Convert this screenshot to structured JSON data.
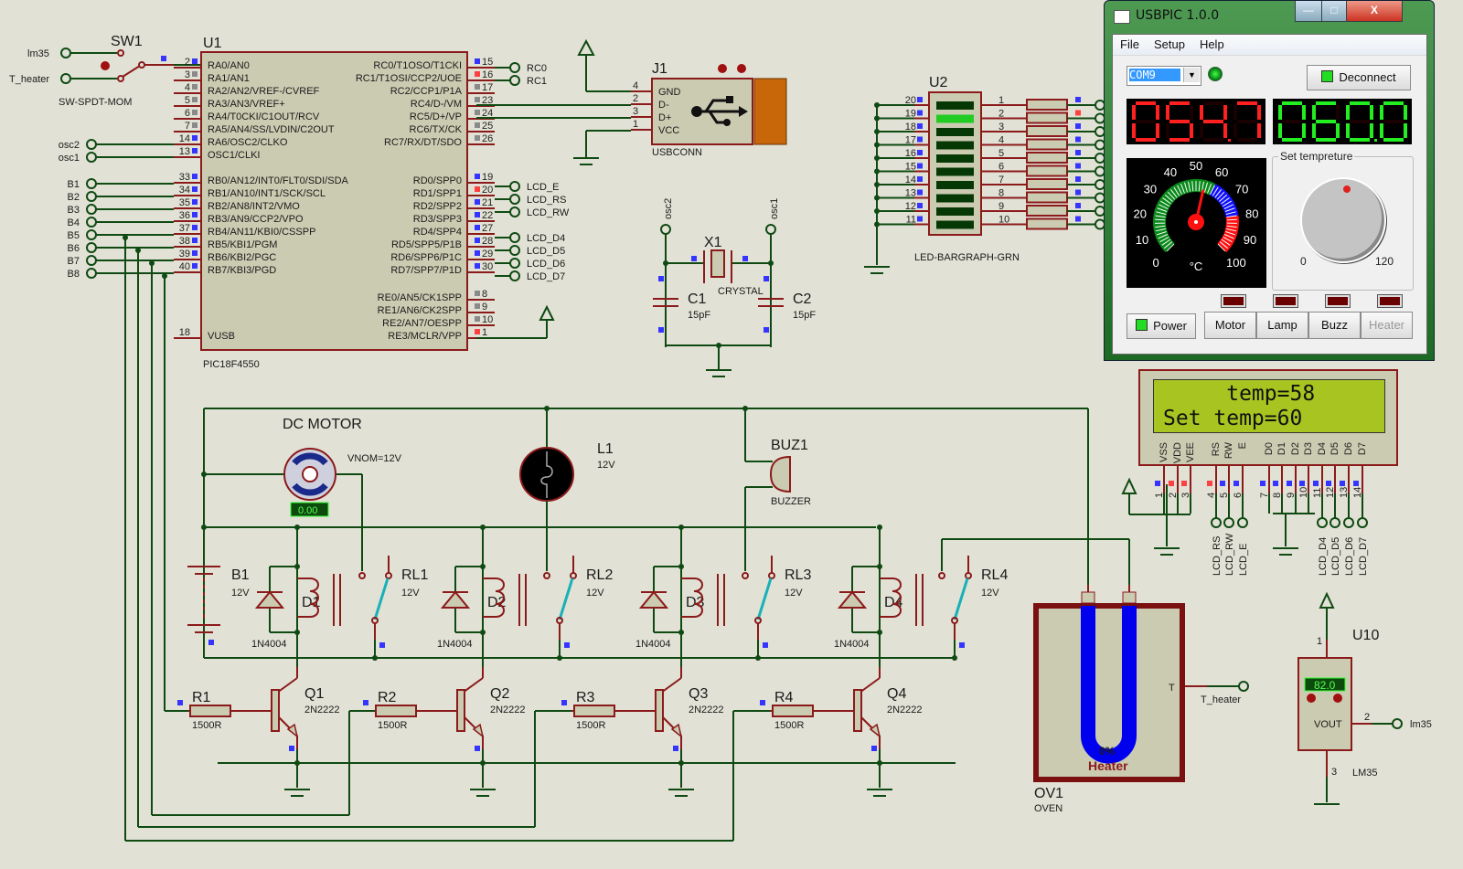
{
  "schematic": {
    "sw1": {
      "ref": "SW1",
      "type": "SW-SPDT-MOM",
      "terminals": [
        "lm35",
        "T_heater"
      ]
    },
    "u1": {
      "ref": "U1",
      "part": "PIC18F4550",
      "left_pins": [
        {
          "num": "2",
          "name": "RA0/AN0"
        },
        {
          "num": "3",
          "name": "RA1/AN1"
        },
        {
          "num": "4",
          "name": "RA2/AN2/VREF-/CVREF"
        },
        {
          "num": "5",
          "name": "RA3/AN3/VREF+"
        },
        {
          "num": "6",
          "name": "RA4/T0CKI/C1OUT/RCV"
        },
        {
          "num": "7",
          "name": "RA5/AN4/SS/LVDIN/C2OUT"
        },
        {
          "num": "14",
          "name": "RA6/OSC2/CLKO"
        },
        {
          "num": "13",
          "name": "OSC1/CLKI"
        },
        {
          "num": "33",
          "name": "RB0/AN12/INT0/FLT0/SDI/SDA"
        },
        {
          "num": "34",
          "name": "RB1/AN10/INT1/SCK/SCL"
        },
        {
          "num": "35",
          "name": "RB2/AN8/INT2/VMO"
        },
        {
          "num": "36",
          "name": "RB3/AN9/CCP2/VPO"
        },
        {
          "num": "37",
          "name": "RB4/AN11/KBI0/CSSPP"
        },
        {
          "num": "38",
          "name": "RB5/KBI1/PGM"
        },
        {
          "num": "39",
          "name": "RB6/KBI2/PGC"
        },
        {
          "num": "40",
          "name": "RB7/KBI3/PGD"
        },
        {
          "num": "18",
          "name": "VUSB"
        }
      ],
      "right_pins": [
        {
          "num": "15",
          "name": "RC0/T1OSO/T1CKI"
        },
        {
          "num": "16",
          "name": "RC1/T1OSI/CCP2/UOE"
        },
        {
          "num": "17",
          "name": "RC2/CCP1/P1A"
        },
        {
          "num": "23",
          "name": "RC4/D-/VM"
        },
        {
          "num": "24",
          "name": "RC5/D+/VP"
        },
        {
          "num": "25",
          "name": "RC6/TX/CK"
        },
        {
          "num": "26",
          "name": "RC7/RX/DT/SDO"
        },
        {
          "num": "19",
          "name": "RD0/SPP0"
        },
        {
          "num": "20",
          "name": "RD1/SPP1"
        },
        {
          "num": "21",
          "name": "RD2/SPP2"
        },
        {
          "num": "22",
          "name": "RD3/SPP3"
        },
        {
          "num": "27",
          "name": "RD4/SPP4"
        },
        {
          "num": "28",
          "name": "RD5/SPP5/P1B"
        },
        {
          "num": "29",
          "name": "RD6/SPP6/P1C"
        },
        {
          "num": "30",
          "name": "RD7/SPP7/P1D"
        },
        {
          "num": "8",
          "name": "RE0/AN5/CK1SPP"
        },
        {
          "num": "9",
          "name": "RE1/AN6/CK2SPP"
        },
        {
          "num": "10",
          "name": "RE2/AN7/OESPP"
        },
        {
          "num": "1",
          "name": "RE3/MCLR/VPP"
        }
      ]
    },
    "left_terminals": [
      "osc2",
      "osc1",
      "B1",
      "B2",
      "B3",
      "B4",
      "B5",
      "B6",
      "B7",
      "B8"
    ],
    "right_terminals": [
      "RC0",
      "RC1",
      "LCD_E",
      "LCD_RS",
      "LCD_RW",
      "LCD_D4",
      "LCD_D5",
      "LCD_D6",
      "LCD_D7"
    ],
    "j1": {
      "ref": "J1",
      "part": "USBCONN",
      "pins": [
        {
          "num": "4",
          "name": "GND"
        },
        {
          "num": "2",
          "name": "D-"
        },
        {
          "num": "3",
          "name": "D+"
        },
        {
          "num": "1",
          "name": "VCC"
        }
      ]
    },
    "x1": {
      "ref": "X1",
      "part": "CRYSTAL",
      "terminals": [
        "osc2",
        "osc1"
      ]
    },
    "c1": {
      "ref": "C1",
      "value": "15pF"
    },
    "c2": {
      "ref": "C2",
      "value": "15pF"
    },
    "u2": {
      "ref": "U2",
      "part": "LED-BARGRAPH-GRN",
      "left_pins": [
        "20",
        "19",
        "18",
        "17",
        "16",
        "15",
        "14",
        "13",
        "12",
        "11"
      ],
      "right_pins": [
        "1",
        "2",
        "3",
        "4",
        "5",
        "6",
        "7",
        "8",
        "9",
        "10"
      ],
      "lit_segment": 2
    },
    "motor": {
      "title": "DC MOTOR",
      "param": "VNOM=12V",
      "readout": "0.00"
    },
    "l1": {
      "ref": "L1",
      "value": "12V"
    },
    "buz1": {
      "ref": "BUZ1",
      "part": "BUZZER"
    },
    "b1": {
      "ref": "B1",
      "value": "12V"
    },
    "relays": [
      {
        "ref": "RL1",
        "value": "12V"
      },
      {
        "ref": "RL2",
        "value": "12V"
      },
      {
        "ref": "RL3",
        "value": "12V"
      },
      {
        "ref": "RL4",
        "value": "12V"
      }
    ],
    "diodes": [
      {
        "ref": "D1",
        "part": "1N4004"
      },
      {
        "ref": "D2",
        "part": "1N4004"
      },
      {
        "ref": "D3",
        "part": "1N4004"
      },
      {
        "ref": "D4",
        "part": "1N4004"
      }
    ],
    "resistors": [
      {
        "ref": "R1",
        "value": "1500R"
      },
      {
        "ref": "R2",
        "value": "1500R"
      },
      {
        "ref": "R3",
        "value": "1500R"
      },
      {
        "ref": "R4",
        "value": "1500R"
      }
    ],
    "transistors": [
      {
        "ref": "Q1",
        "part": "2N2222"
      },
      {
        "ref": "Q2",
        "part": "2N2222"
      },
      {
        "ref": "Q3",
        "part": "2N2222"
      },
      {
        "ref": "Q4",
        "part": "2N2222"
      }
    ],
    "lcd": {
      "line1": "     temp=58",
      "line2": "Set temp=60",
      "pin_names": [
        "VSS",
        "VDD",
        "VEE",
        "RS",
        "RW",
        "E",
        "D0",
        "D1",
        "D2",
        "D3",
        "D4",
        "D5",
        "D6",
        "D7"
      ],
      "pin_nums": [
        "1",
        "2",
        "3",
        "4",
        "5",
        "6",
        "7",
        "8",
        "9",
        "10",
        "11",
        "12",
        "13",
        "14"
      ],
      "terminals": [
        "LCD_RS",
        "LCD_RW",
        "LCD_E",
        "LCD_D4",
        "LCD_D5",
        "LCD_D6",
        "LCD_D7"
      ]
    },
    "ov1": {
      "ref": "OV1",
      "part": "OVEN",
      "heater_label": "Heater",
      "heater_percent": "0%",
      "pin_t": "T",
      "terminal": "T_heater"
    },
    "u10": {
      "ref": "U10",
      "part": "LM35",
      "readout": "82.0",
      "pin_vout": "VOUT",
      "pins": [
        "1",
        "2",
        "3"
      ],
      "terminal": "lm35"
    }
  },
  "app": {
    "title": "USBPIC 1.0.0",
    "window_buttons": {
      "minimize": "—",
      "maximize": "□",
      "close": "X"
    },
    "menu": [
      "File",
      "Setup",
      "Help"
    ],
    "port": "COM9",
    "connect_button": "Deconnect",
    "temp_display": "054.7",
    "set_display": "060.0",
    "gauge": {
      "ticks": [
        "0",
        "10",
        "20",
        "30",
        "40",
        "50",
        "60",
        "70",
        "80",
        "90",
        "100"
      ],
      "unit": "°C",
      "value": 54.7,
      "min": 0,
      "max": 100
    },
    "set_temperature": {
      "legend": "Set tempreture",
      "min_label": "0",
      "max_label": "120",
      "value": 60
    },
    "buttons": [
      "Power",
      "Motor",
      "Lamp",
      "Buzz",
      "Heater"
    ],
    "colors": {
      "temp": "#ff2020",
      "set": "#22ee22",
      "gauge_green": "#0a8a1a",
      "gauge_blue": "#1010ff",
      "gauge_red": "#ff1010"
    }
  }
}
